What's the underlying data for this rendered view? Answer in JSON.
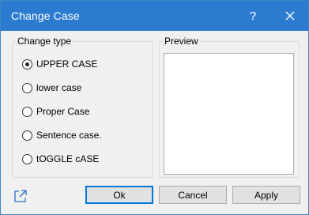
{
  "window": {
    "title": "Change Case",
    "help_label": "?"
  },
  "change_type": {
    "legend": "Change type",
    "options": [
      {
        "label": "UPPER CASE",
        "selected": true
      },
      {
        "label": "lower case",
        "selected": false
      },
      {
        "label": "Proper Case",
        "selected": false
      },
      {
        "label": "Sentence case.",
        "selected": false
      },
      {
        "label": "tOGGLE cASE",
        "selected": false
      }
    ]
  },
  "preview": {
    "legend": "Preview",
    "text": ""
  },
  "buttons": {
    "ok": "Ok",
    "cancel": "Cancel",
    "apply": "Apply"
  },
  "icons": {
    "external": "external-link-icon",
    "close": "close-icon"
  },
  "colors": {
    "titlebar": "#2b7bd0",
    "accent": "#0078d7"
  }
}
